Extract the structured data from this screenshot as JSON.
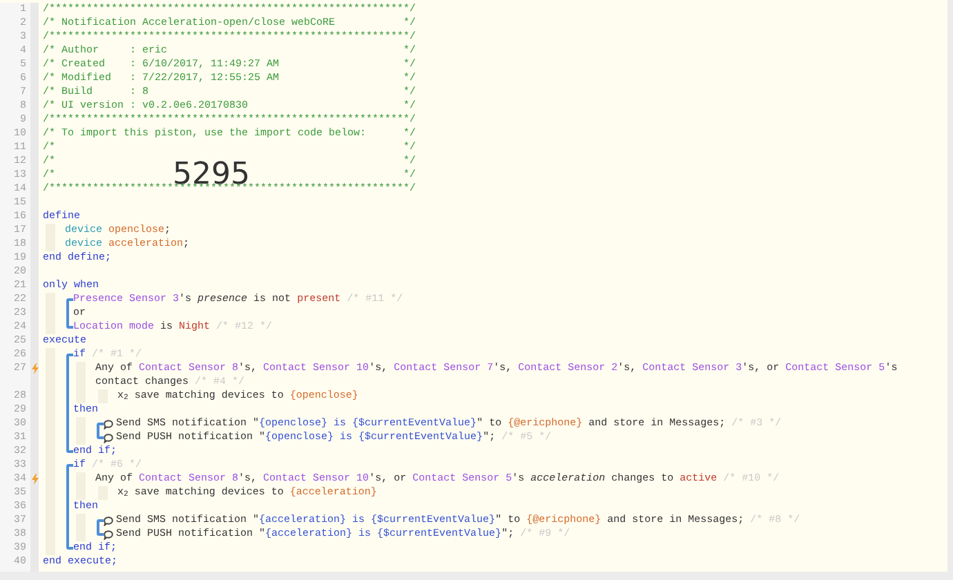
{
  "lines": [
    {
      "number": "1",
      "kind": "header",
      "trigger": false,
      "text": "/**********************************************************/"
    },
    {
      "number": "2",
      "kind": "header",
      "trigger": false,
      "text": "/* Notification Acceleration-open/close webCoRE",
      "end": "*/"
    },
    {
      "number": "3",
      "kind": "header",
      "trigger": false,
      "text": "/**********************************************************/"
    },
    {
      "number": "4",
      "kind": "header",
      "trigger": false,
      "text": "/* Author     : eric",
      "end": "*/"
    },
    {
      "number": "5",
      "kind": "header",
      "trigger": false,
      "text": "/* Created    : 6/10/2017, 11:49:27 AM",
      "end": "*/"
    },
    {
      "number": "6",
      "kind": "header",
      "trigger": false,
      "text": "/* Modified   : 7/22/2017, 12:55:25 AM",
      "end": "*/"
    },
    {
      "number": "7",
      "kind": "header",
      "trigger": false,
      "text": "/* Build      : 8",
      "end": "*/"
    },
    {
      "number": "8",
      "kind": "header",
      "trigger": false,
      "text": "/* UI version : v0.2.0e6.20170830",
      "end": "*/"
    },
    {
      "number": "9",
      "kind": "header",
      "trigger": false,
      "text": "/**********************************************************/"
    },
    {
      "number": "10",
      "kind": "header",
      "trigger": false,
      "text": "/* To import this piston, use the import code below:",
      "end": "*/"
    },
    {
      "number": "11",
      "kind": "header",
      "trigger": false,
      "text": "/*",
      "end": "*/"
    },
    {
      "number": "12",
      "kind": "header",
      "trigger": false,
      "text": "/*",
      "end": "*/"
    },
    {
      "number": "13",
      "kind": "header",
      "trigger": false,
      "text": "/*",
      "end": "*/",
      "import_code": "5295"
    },
    {
      "number": "14",
      "kind": "header",
      "trigger": false,
      "text": "/**********************************************************/"
    },
    {
      "number": "15",
      "kind": "blank",
      "trigger": false
    },
    {
      "number": "16",
      "kind": "code",
      "trigger": false,
      "segments": [
        {
          "kind": "keyword",
          "text": "define"
        }
      ],
      "children": [
        {
          "number": "17",
          "kind": "code",
          "trigger": false,
          "segments": [
            {
              "kind": "type",
              "text": "device "
            },
            {
              "kind": "variable",
              "text": "openclose"
            },
            {
              "kind": "text",
              "text": ";"
            }
          ]
        },
        {
          "number": "18",
          "kind": "code",
          "trigger": false,
          "segments": [
            {
              "kind": "type",
              "text": "device "
            },
            {
              "kind": "variable",
              "text": "acceleration"
            },
            {
              "kind": "text",
              "text": ";"
            }
          ]
        }
      ]
    },
    {
      "number": "19",
      "kind": "code",
      "trigger": false,
      "segments": [
        {
          "kind": "keyword",
          "text": "end define;"
        }
      ]
    },
    {
      "number": "20",
      "kind": "blank",
      "trigger": false
    },
    {
      "number": "21",
      "kind": "code",
      "trigger": false,
      "segments": [
        {
          "kind": "keyword",
          "text": "only when"
        }
      ],
      "children": [
        {
          "kind": "block",
          "children": [
            {
              "number": "22",
              "kind": "code",
              "trigger": false,
              "segments": [
                {
                  "kind": "device",
                  "text": "Presence Sensor 3"
                },
                {
                  "kind": "text",
                  "text": "'s "
                },
                {
                  "kind": "attribute",
                  "text": "presence"
                },
                {
                  "kind": "text",
                  "text": " is not "
                },
                {
                  "kind": "value",
                  "text": "present"
                },
                {
                  "kind": "comment",
                  "text": " /* #11 */"
                }
              ]
            },
            {
              "number": "23",
              "kind": "code",
              "trigger": false,
              "segments": [
                {
                  "kind": "text",
                  "text": "or"
                }
              ]
            },
            {
              "number": "24",
              "kind": "code",
              "trigger": false,
              "segments": [
                {
                  "kind": "device",
                  "text": "Location mode"
                },
                {
                  "kind": "text",
                  "text": " is "
                },
                {
                  "kind": "value",
                  "text": "Night"
                },
                {
                  "kind": "comment",
                  "text": " /* #12 */"
                }
              ]
            }
          ]
        }
      ]
    },
    {
      "number": "25",
      "kind": "code",
      "trigger": false,
      "segments": [
        {
          "kind": "keyword",
          "text": "execute"
        }
      ],
      "children": [
        {
          "kind": "block",
          "children": [
            {
              "number": "26",
              "kind": "code",
              "trigger": false,
              "segments": [
                {
                  "kind": "keyword",
                  "text": "if"
                },
                {
                  "kind": "comment",
                  "text": " /* #1 */"
                }
              ],
              "children": [
                {
                  "number": "27",
                  "kind": "code",
                  "trigger": true,
                  "segments": [
                    {
                      "kind": "text",
                      "text": "Any of "
                    },
                    {
                      "kind": "device",
                      "text": "Contact Sensor 8"
                    },
                    {
                      "kind": "text",
                      "text": "'s, "
                    },
                    {
                      "kind": "device",
                      "text": "Contact Sensor 10"
                    },
                    {
                      "kind": "text",
                      "text": "'s, "
                    },
                    {
                      "kind": "device",
                      "text": "Contact Sensor 7"
                    },
                    {
                      "kind": "text",
                      "text": "'s, "
                    },
                    {
                      "kind": "device",
                      "text": "Contact Sensor 2"
                    },
                    {
                      "kind": "text",
                      "text": "'s, "
                    },
                    {
                      "kind": "device",
                      "text": "Contact Sensor 3"
                    },
                    {
                      "kind": "text",
                      "text": "'s, or "
                    },
                    {
                      "kind": "device",
                      "text": "Contact Sensor 5"
                    },
                    {
                      "kind": "text",
                      "text": "'s"
                    }
                  ],
                  "wrap": [
                    {
                      "kind": "text",
                      "text": "contact changes"
                    },
                    {
                      "kind": "comment",
                      "text": " /* #4 */"
                    }
                  ],
                  "children": [
                    {
                      "number": "28",
                      "kind": "code",
                      "trigger": false,
                      "segments": [
                        {
                          "kind": "text",
                          "text": "x$_{2}$ save matching devices to "
                        },
                        {
                          "kind": "variable",
                          "text": "{openclose}"
                        }
                      ]
                    }
                  ]
                }
              ]
            },
            {
              "number": "29",
              "kind": "code",
              "trigger": false,
              "segments": [
                {
                  "kind": "keyword",
                  "text": "then"
                }
              ],
              "children": [
                {
                  "kind": "block",
                  "children": [
                    {
                      "number": "30",
                      "kind": "action",
                      "trigger": false,
                      "segments": [
                        {
                          "kind": "text",
                          "text": "Send SMS notification \""
                        },
                        {
                          "kind": "string",
                          "text": "{openclose} is {$currentEventValue}"
                        },
                        {
                          "kind": "text",
                          "text": "\" to "
                        },
                        {
                          "kind": "variable",
                          "text": "{@ericphone}"
                        },
                        {
                          "kind": "text",
                          "text": " and store in Messages;"
                        },
                        {
                          "kind": "comment",
                          "text": " /* #3 */"
                        }
                      ]
                    },
                    {
                      "number": "31",
                      "kind": "action",
                      "trigger": false,
                      "segments": [
                        {
                          "kind": "text",
                          "text": "Send PUSH notification \""
                        },
                        {
                          "kind": "string",
                          "text": "{openclose} is {$currentEventValue}"
                        },
                        {
                          "kind": "text",
                          "text": "\";"
                        },
                        {
                          "kind": "comment",
                          "text": " /* #5 */"
                        }
                      ]
                    }
                  ]
                }
              ]
            },
            {
              "number": "32",
              "kind": "code",
              "trigger": false,
              "segments": [
                {
                  "kind": "keyword",
                  "text": "end if;"
                }
              ]
            }
          ]
        },
        {
          "kind": "block",
          "children": [
            {
              "number": "33",
              "kind": "code",
              "trigger": false,
              "segments": [
                {
                  "kind": "keyword",
                  "text": "if"
                },
                {
                  "kind": "comment",
                  "text": " /* #6 */"
                }
              ],
              "children": [
                {
                  "number": "34",
                  "kind": "code",
                  "trigger": true,
                  "segments": [
                    {
                      "kind": "text",
                      "text": "Any of "
                    },
                    {
                      "kind": "device",
                      "text": "Contact Sensor 8"
                    },
                    {
                      "kind": "text",
                      "text": "'s, "
                    },
                    {
                      "kind": "device",
                      "text": "Contact Sensor 10"
                    },
                    {
                      "kind": "text",
                      "text": "'s, or "
                    },
                    {
                      "kind": "device",
                      "text": "Contact Sensor 5"
                    },
                    {
                      "kind": "text",
                      "text": "'s "
                    },
                    {
                      "kind": "attribute",
                      "text": "acceleration"
                    },
                    {
                      "kind": "text",
                      "text": " changes to "
                    },
                    {
                      "kind": "value",
                      "text": "active"
                    },
                    {
                      "kind": "comment",
                      "text": " /* #10 */"
                    }
                  ],
                  "children": [
                    {
                      "number": "35",
                      "kind": "code",
                      "trigger": false,
                      "segments": [
                        {
                          "kind": "text",
                          "text": "x$_{2}$ save matching devices to "
                        },
                        {
                          "kind": "variable",
                          "text": "{acceleration}"
                        }
                      ]
                    }
                  ]
                }
              ]
            },
            {
              "number": "36",
              "kind": "code",
              "trigger": false,
              "segments": [
                {
                  "kind": "keyword",
                  "text": "then"
                }
              ],
              "children": [
                {
                  "kind": "block",
                  "children": [
                    {
                      "number": "37",
                      "kind": "action",
                      "trigger": false,
                      "segments": [
                        {
                          "kind": "text",
                          "text": "Send SMS notification \""
                        },
                        {
                          "kind": "string",
                          "text": "{acceleration} is {$currentEventValue}"
                        },
                        {
                          "kind": "text",
                          "text": "\" to "
                        },
                        {
                          "kind": "variable",
                          "text": "{@ericphone}"
                        },
                        {
                          "kind": "text",
                          "text": " and store in Messages;"
                        },
                        {
                          "kind": "comment",
                          "text": " /* #8 */"
                        }
                      ]
                    },
                    {
                      "number": "38",
                      "kind": "action",
                      "trigger": false,
                      "segments": [
                        {
                          "kind": "text",
                          "text": "Send PUSH notification \""
                        },
                        {
                          "kind": "string",
                          "text": "{acceleration} is {$currentEventValue}"
                        },
                        {
                          "kind": "text",
                          "text": "\";"
                        },
                        {
                          "kind": "comment",
                          "text": " /* #9 */"
                        }
                      ]
                    }
                  ]
                }
              ]
            },
            {
              "number": "39",
              "kind": "code",
              "trigger": false,
              "segments": [
                {
                  "kind": "keyword",
                  "text": "end if;"
                }
              ]
            }
          ]
        }
      ]
    },
    {
      "number": "40",
      "kind": "code",
      "trigger": false,
      "segments": [
        {
          "kind": "keyword",
          "text": "end execute;"
        }
      ]
    }
  ]
}
